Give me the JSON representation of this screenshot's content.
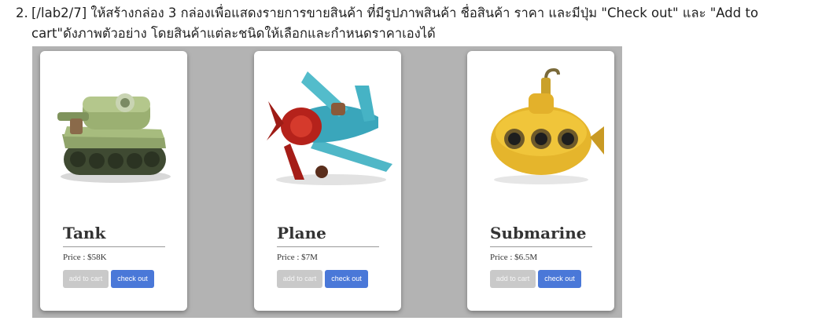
{
  "instruction": {
    "number": "2.",
    "line1": "[/lab2/7] ให้สร้างกล่อง 3 กล่องเพื่อแสดงรายการขายสินค้า ที่มีรูปภาพสินค้า ชื่อสินค้า ราคา และมีปุ่ม \"Check out\" และ \"Add to",
    "line2": "cart\"ดังภาพตัวอย่าง โดยสินค้าแต่ละชนิดให้เลือกและกำหนดราคาเองได้"
  },
  "products": [
    {
      "name": "Tank",
      "price_label": "Price : ",
      "price": "$58K",
      "image": "toy-tank-icon",
      "add_label": "add to cart",
      "checkout_label": "check out"
    },
    {
      "name": "Plane",
      "price_label": "Price : ",
      "price": "$7M",
      "image": "toy-plane-icon",
      "add_label": "add to cart",
      "checkout_label": "check out"
    },
    {
      "name": "Submarine",
      "price_label": "Price : ",
      "price": "$6.5M",
      "image": "toy-submarine-icon",
      "add_label": "add to cart",
      "checkout_label": "check out"
    }
  ],
  "colors": {
    "stage": "#b3b3b3",
    "card": "#ffffff",
    "add_button": "#c9c9c9",
    "checkout_button": "#4a78d8"
  }
}
